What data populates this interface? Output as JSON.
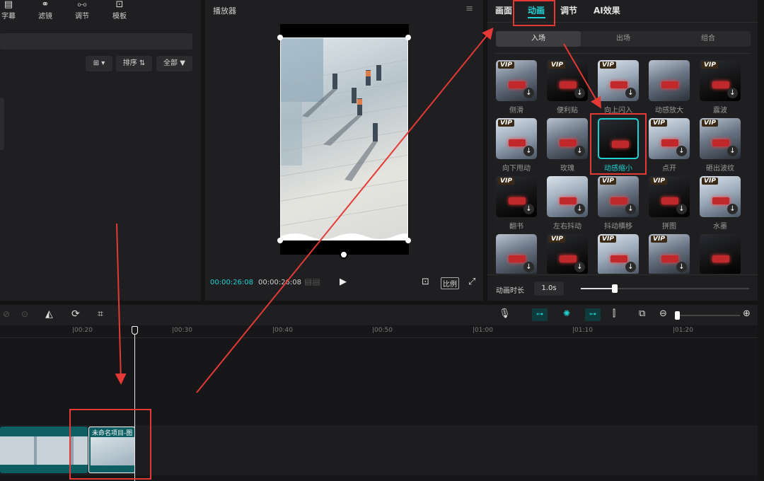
{
  "media_toolbar": {
    "items": [
      {
        "label": "字幕",
        "icon": "text-icon"
      },
      {
        "label": "滤镜",
        "icon": "filter-icon"
      },
      {
        "label": "调节",
        "icon": "adjust-icon"
      },
      {
        "label": "模板",
        "icon": "template-icon"
      }
    ]
  },
  "media_controls": {
    "view_label": "▾",
    "sort_label": "排序",
    "filter_label": "全部"
  },
  "player": {
    "title": "播放器",
    "current_time": "00:00:26:08",
    "total_time": "00:00:26:08",
    "ratio_label": "比例"
  },
  "right_panel": {
    "tabs": [
      "画面",
      "动画",
      "调节",
      "AI效果"
    ],
    "active_tab": "动画",
    "subtabs": [
      "入场",
      "出场",
      "组合"
    ],
    "duration_label": "动画时长",
    "duration_value": "1.0s",
    "duration_fraction": 0.2,
    "effects": [
      {
        "name": "侧滑",
        "vip": true,
        "dl": true
      },
      {
        "name": "便利贴",
        "vip": true,
        "dl": true
      },
      {
        "name": "向上闪入",
        "vip": true,
        "dl": true
      },
      {
        "name": "动感放大",
        "vip": false,
        "dl": false
      },
      {
        "name": "震波",
        "vip": true,
        "dl": true
      },
      {
        "name": "向下甩动",
        "vip": true,
        "dl": true
      },
      {
        "name": "玫瑰",
        "vip": false,
        "dl": true
      },
      {
        "name": "动感缩小",
        "vip": false,
        "dl": false,
        "selected": true
      },
      {
        "name": "点开",
        "vip": true,
        "dl": true
      },
      {
        "name": "砸出波纹",
        "vip": true,
        "dl": true
      },
      {
        "name": "翻书",
        "vip": true,
        "dl": true
      },
      {
        "name": "左右抖动",
        "vip": false,
        "dl": true
      },
      {
        "name": "抖动横移",
        "vip": true,
        "dl": true
      },
      {
        "name": "拼图",
        "vip": true,
        "dl": true
      },
      {
        "name": "水墨",
        "vip": true,
        "dl": true
      },
      {
        "name": "",
        "vip": false,
        "dl": true
      },
      {
        "name": "",
        "vip": true,
        "dl": true
      },
      {
        "name": "",
        "vip": true,
        "dl": true
      },
      {
        "name": "",
        "vip": true,
        "dl": true
      },
      {
        "name": "",
        "vip": false,
        "dl": false
      }
    ]
  },
  "timeline": {
    "ticks": [
      "|00:20",
      "|00:30",
      "|00:40",
      "|00:50",
      "|01:00",
      "|01:10",
      "|01:20"
    ],
    "clip_label": "未命名项目-图"
  },
  "colors": {
    "accent": "#1fd1d1",
    "annotation": "#e53935",
    "clip": "#0e5f63"
  }
}
